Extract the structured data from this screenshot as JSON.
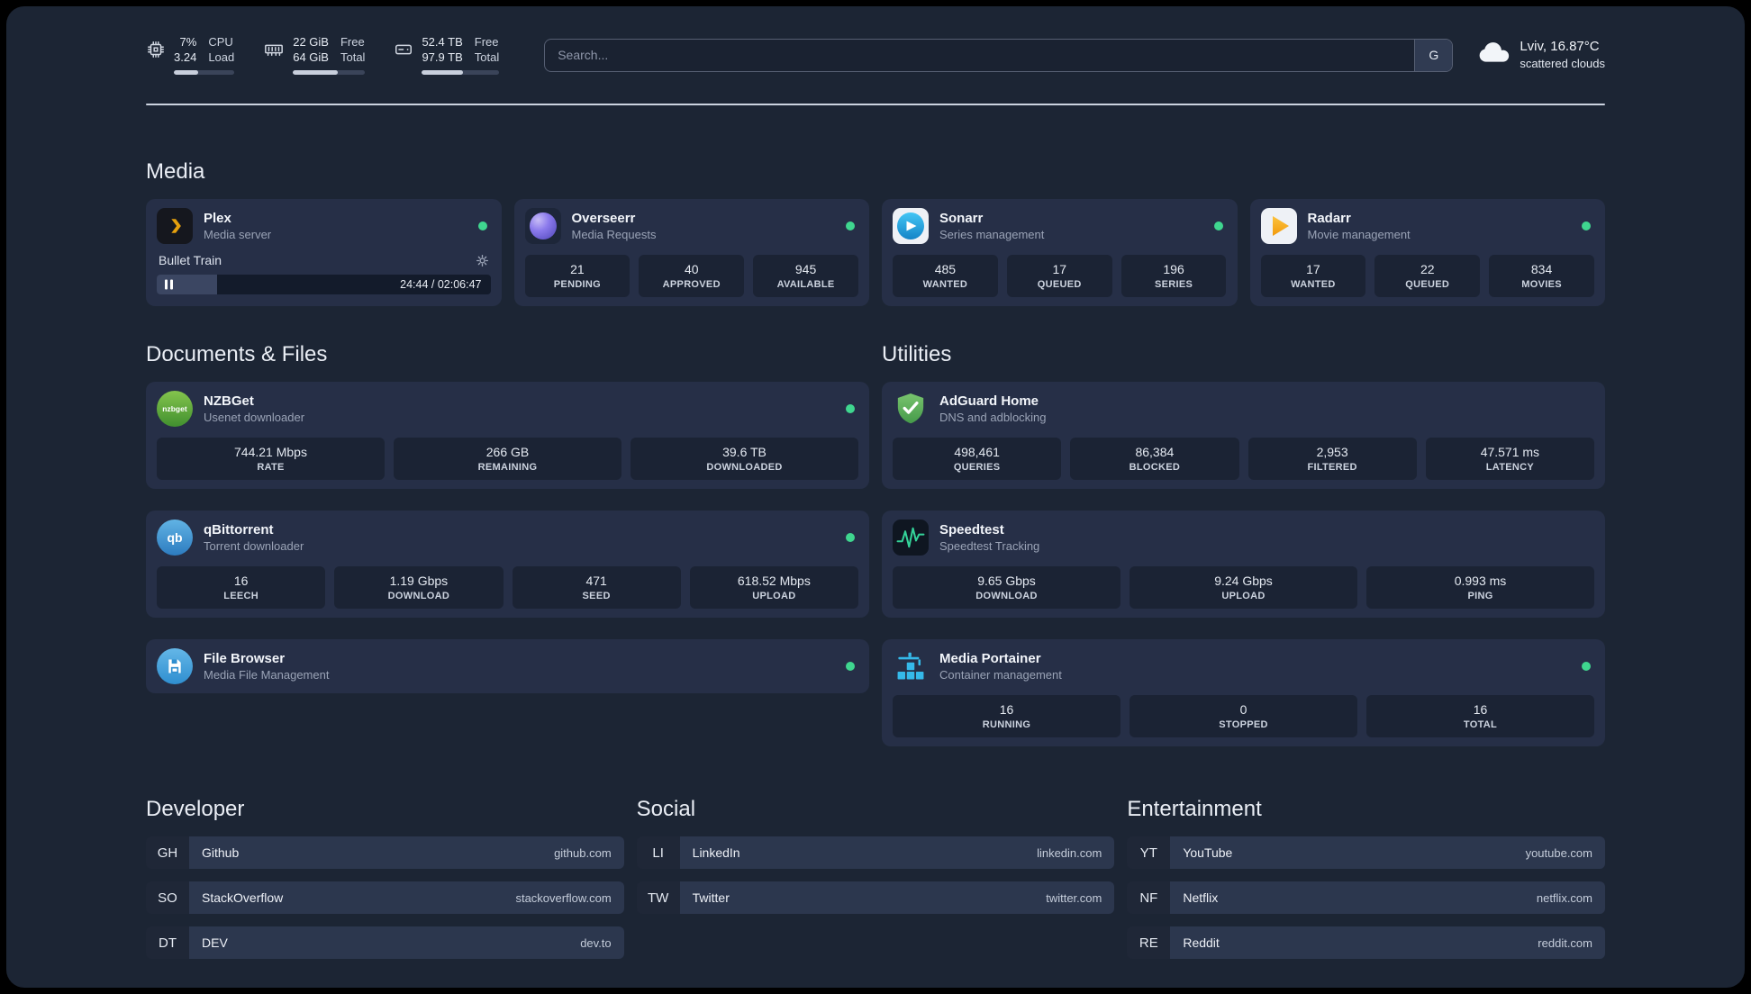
{
  "topbar": {
    "resources": [
      {
        "values": [
          "7%",
          "3.24"
        ],
        "labels": [
          "CPU",
          "Load"
        ],
        "percent": 40
      },
      {
        "values": [
          "22 GiB",
          "64 GiB"
        ],
        "labels": [
          "Free",
          "Total"
        ],
        "percent": 62
      },
      {
        "values": [
          "52.4 TB",
          "97.9 TB"
        ],
        "labels": [
          "Free",
          "Total"
        ],
        "percent": 53
      }
    ],
    "search": {
      "placeholder": "Search...",
      "button_label": "G"
    },
    "weather": {
      "line1": "Lviv, 16.87°C",
      "line2": "scattered clouds"
    }
  },
  "media": {
    "title": "Media",
    "plex": {
      "name": "Plex",
      "desc": "Media server",
      "now_playing": "Bullet Train",
      "time": "24:44 / 02:06:47",
      "progress": 18
    },
    "overseerr": {
      "name": "Overseerr",
      "desc": "Media Requests",
      "stats": [
        {
          "value": "21",
          "label": "PENDING"
        },
        {
          "value": "40",
          "label": "APPROVED"
        },
        {
          "value": "945",
          "label": "AVAILABLE"
        }
      ]
    },
    "sonarr": {
      "name": "Sonarr",
      "desc": "Series management",
      "stats": [
        {
          "value": "485",
          "label": "WANTED"
        },
        {
          "value": "17",
          "label": "QUEUED"
        },
        {
          "value": "196",
          "label": "SERIES"
        }
      ]
    },
    "radarr": {
      "name": "Radarr",
      "desc": "Movie management",
      "stats": [
        {
          "value": "17",
          "label": "WANTED"
        },
        {
          "value": "22",
          "label": "QUEUED"
        },
        {
          "value": "834",
          "label": "MOVIES"
        }
      ]
    }
  },
  "documents": {
    "title": "Documents & Files",
    "nzbget": {
      "name": "NZBGet",
      "desc": "Usenet downloader",
      "icon_text": "nzbget",
      "stats": [
        {
          "value": "744.21 Mbps",
          "label": "RATE"
        },
        {
          "value": "266 GB",
          "label": "REMAINING"
        },
        {
          "value": "39.6 TB",
          "label": "DOWNLOADED"
        }
      ]
    },
    "qbittorrent": {
      "name": "qBittorrent",
      "desc": "Torrent downloader",
      "icon_text": "qb",
      "stats": [
        {
          "value": "16",
          "label": "LEECH"
        },
        {
          "value": "1.19 Gbps",
          "label": "DOWNLOAD"
        },
        {
          "value": "471",
          "label": "SEED"
        },
        {
          "value": "618.52 Mbps",
          "label": "UPLOAD"
        }
      ]
    },
    "filebrowser": {
      "name": "File Browser",
      "desc": "Media File Management"
    }
  },
  "utilities": {
    "title": "Utilities",
    "adguard": {
      "name": "AdGuard Home",
      "desc": "DNS and adblocking",
      "stats": [
        {
          "value": "498,461",
          "label": "QUERIES"
        },
        {
          "value": "86,384",
          "label": "BLOCKED"
        },
        {
          "value": "2,953",
          "label": "FILTERED"
        },
        {
          "value": "47.571 ms",
          "label": "LATENCY"
        }
      ]
    },
    "speedtest": {
      "name": "Speedtest",
      "desc": "Speedtest Tracking",
      "stats": [
        {
          "value": "9.65 Gbps",
          "label": "DOWNLOAD"
        },
        {
          "value": "9.24 Gbps",
          "label": "UPLOAD"
        },
        {
          "value": "0.993 ms",
          "label": "PING"
        }
      ]
    },
    "portainer": {
      "name": "Media Portainer",
      "desc": "Container management",
      "stats": [
        {
          "value": "16",
          "label": "RUNNING"
        },
        {
          "value": "0",
          "label": "STOPPED"
        },
        {
          "value": "16",
          "label": "TOTAL"
        }
      ]
    }
  },
  "bookmarks": {
    "developer": {
      "title": "Developer",
      "items": [
        {
          "abbr": "GH",
          "name": "Github",
          "url": "github.com"
        },
        {
          "abbr": "SO",
          "name": "StackOverflow",
          "url": "stackoverflow.com"
        },
        {
          "abbr": "DT",
          "name": "DEV",
          "url": "dev.to"
        }
      ]
    },
    "social": {
      "title": "Social",
      "items": [
        {
          "abbr": "LI",
          "name": "LinkedIn",
          "url": "linkedin.com"
        },
        {
          "abbr": "TW",
          "name": "Twitter",
          "url": "twitter.com"
        }
      ]
    },
    "entertainment": {
      "title": "Entertainment",
      "items": [
        {
          "abbr": "YT",
          "name": "YouTube",
          "url": "youtube.com"
        },
        {
          "abbr": "NF",
          "name": "Netflix",
          "url": "netflix.com"
        },
        {
          "abbr": "RE",
          "name": "Reddit",
          "url": "reddit.com"
        }
      ]
    }
  }
}
